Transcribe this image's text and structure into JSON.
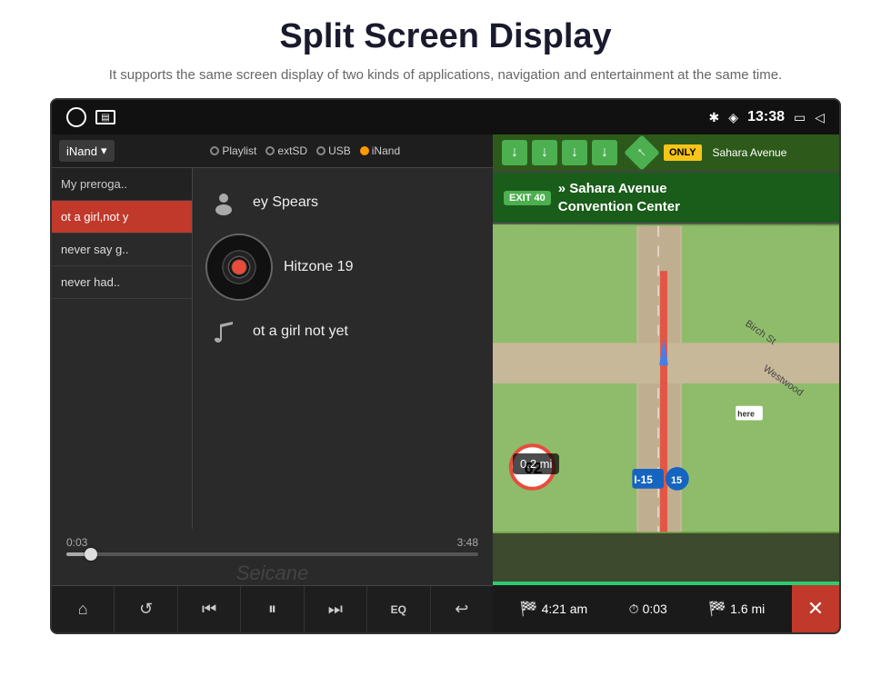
{
  "header": {
    "title": "Split Screen Display",
    "subtitle": "It supports the same screen display of two kinds of applications,\nnavigation and entertainment at the same time."
  },
  "statusBar": {
    "time": "13:38",
    "icons": [
      "bluetooth",
      "location",
      "window",
      "back"
    ]
  },
  "musicPanel": {
    "sourceSelector": "iNand",
    "sourceOptions": [
      "Playlist",
      "extSD",
      "USB",
      "iNand"
    ],
    "activeSource": "iNand",
    "playlist": [
      {
        "title": "My preroga..",
        "active": false
      },
      {
        "title": "ot a girl,not y",
        "active": true
      },
      {
        "title": "never say g..",
        "active": false
      },
      {
        "title": "never had..",
        "active": false
      }
    ],
    "nowPlaying": {
      "artist": "ey Spears",
      "album": "Hitzone 19",
      "song": "ot a girl not yet"
    },
    "progress": {
      "current": "0:03",
      "total": "3:48",
      "percent": 6
    },
    "watermark": "Seicane",
    "controls": [
      "home",
      "repeat",
      "prev",
      "pause",
      "next",
      "eq",
      "back"
    ]
  },
  "navPanel": {
    "exitBadge": "EXIT 40",
    "exitText": "» Sahara Avenue\nConvention Center",
    "signText": "Sahara Avenue",
    "onlyLabel": "ONLY",
    "speedLimit": "62",
    "highwayLabel": "I-15",
    "highwayNumber": "15",
    "distance": "0.2 mi",
    "eta": {
      "arrival": "4:21 am",
      "elapsed": "0:03",
      "remaining": "1.6 mi"
    }
  },
  "colors": {
    "accent": "#2ecc71",
    "danger": "#c0392b",
    "navGreen": "#1a5c1a",
    "highway": "#1565c0",
    "only": "#f5c518"
  }
}
